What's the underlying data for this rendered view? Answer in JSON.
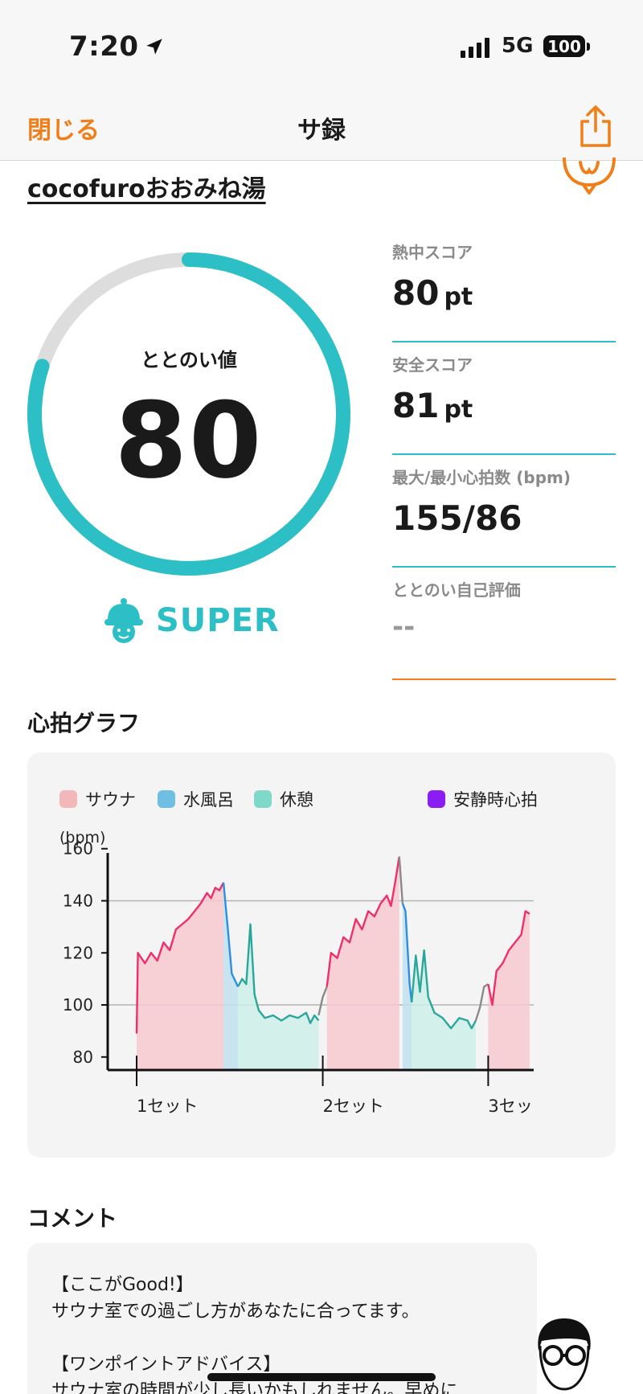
{
  "status_bar": {
    "time": "7:20",
    "network": "5G",
    "battery": "100"
  },
  "navbar": {
    "close_label": "閉じる",
    "title": "サ録"
  },
  "facility_name": "cocofuroおおみね湯",
  "totonoi": {
    "label": "ととのい値",
    "value": 80,
    "gauge_percent": 80,
    "rank": "SUPER"
  },
  "stats": [
    {
      "label": "熱中スコア",
      "value": "80",
      "unit": "pt"
    },
    {
      "label": "安全スコア",
      "value": "81",
      "unit": "pt"
    },
    {
      "label": "最大/最小心拍数 (bpm)",
      "value": "155/86",
      "unit": ""
    },
    {
      "label": "ととのい自己評価",
      "value": "--",
      "unit": ""
    }
  ],
  "heart_section_title": "心拍グラフ",
  "colors": {
    "accent_orange": "#f07f1a",
    "teal": "#2cbfc6",
    "sauna": "#ef2f6b",
    "sauna_fill": "#f6c9cf",
    "bath": "#2f8ee0",
    "bath_fill": "#bfe0ee",
    "rest": "#2aa79b",
    "rest_fill": "#cdeee7",
    "resting_hr": "#8a1ef2",
    "gauge_track": "#dddddd"
  },
  "chart_data": {
    "type": "line",
    "ylabel": "(bpm)",
    "yticks": [
      80,
      100,
      120,
      140,
      160
    ],
    "ylim": [
      75,
      163
    ],
    "reference_lines": [
      100,
      140
    ],
    "legend": [
      {
        "name": "サウナ",
        "color": "#f2b7b9"
      },
      {
        "name": "水風呂",
        "color": "#6fbfe2"
      },
      {
        "name": "休憩",
        "color": "#7fd8c9"
      },
      {
        "name": "安静時心拍",
        "color": "#8a1ef2"
      }
    ],
    "set_labels": [
      "1セット",
      "2セット",
      "3セッ"
    ],
    "set_positions": [
      0,
      45,
      85
    ],
    "xlim": [
      -7,
      96
    ],
    "segments": [
      {
        "phase": "sauna",
        "points": [
          [
            0,
            89
          ],
          [
            0.3,
            120
          ],
          [
            2,
            116
          ],
          [
            3.5,
            120
          ],
          [
            5,
            117
          ],
          [
            6.5,
            124
          ],
          [
            8,
            121
          ],
          [
            9.5,
            129
          ],
          [
            11,
            131
          ],
          [
            12.5,
            133
          ],
          [
            14,
            136
          ],
          [
            15.5,
            139
          ],
          [
            17,
            143
          ],
          [
            18,
            141
          ],
          [
            19,
            145
          ],
          [
            20,
            144
          ],
          [
            21,
            147
          ]
        ]
      },
      {
        "phase": "bath",
        "points": [
          [
            21,
            147
          ],
          [
            22,
            130
          ],
          [
            23,
            112
          ],
          [
            24.5,
            107
          ]
        ]
      },
      {
        "phase": "rest",
        "points": [
          [
            24.5,
            107
          ],
          [
            25.5,
            110
          ],
          [
            26.5,
            108
          ],
          [
            27.5,
            131
          ],
          [
            28.5,
            104
          ],
          [
            29.5,
            98
          ],
          [
            31,
            95
          ],
          [
            33,
            96
          ],
          [
            35,
            94
          ],
          [
            37,
            96
          ],
          [
            39,
            95
          ],
          [
            41,
            97
          ],
          [
            42,
            93
          ],
          [
            43,
            96
          ],
          [
            44,
            94
          ]
        ]
      },
      {
        "phase": "other",
        "points": [
          [
            44,
            96
          ],
          [
            45,
            103
          ],
          [
            46,
            107
          ]
        ]
      },
      {
        "phase": "sauna",
        "points": [
          [
            46,
            107
          ],
          [
            47,
            120
          ],
          [
            48.5,
            118
          ],
          [
            50,
            126
          ],
          [
            51.5,
            124
          ],
          [
            53,
            133
          ],
          [
            54.5,
            129
          ],
          [
            56,
            136
          ],
          [
            57.5,
            134
          ],
          [
            59,
            139
          ],
          [
            60.5,
            142
          ],
          [
            61.5,
            138
          ],
          [
            62.5,
            147
          ],
          [
            63.5,
            157
          ]
        ]
      },
      {
        "phase": "other",
        "points": [
          [
            63.5,
            157
          ],
          [
            64.3,
            139
          ]
        ]
      },
      {
        "phase": "bath",
        "points": [
          [
            64.3,
            139
          ],
          [
            65,
            136
          ],
          [
            66,
            108
          ],
          [
            66.5,
            101
          ]
        ]
      },
      {
        "phase": "rest",
        "points": [
          [
            66.5,
            101
          ],
          [
            67.5,
            119
          ],
          [
            68.5,
            105
          ],
          [
            69.5,
            121
          ],
          [
            70.5,
            103
          ],
          [
            72,
            97
          ],
          [
            74,
            95
          ],
          [
            76,
            91
          ],
          [
            78,
            95
          ],
          [
            80,
            94
          ],
          [
            81,
            91
          ],
          [
            82,
            94
          ]
        ]
      },
      {
        "phase": "other",
        "points": [
          [
            82,
            94
          ],
          [
            83,
            99
          ],
          [
            84,
            107
          ],
          [
            85,
            108
          ]
        ]
      },
      {
        "phase": "sauna",
        "points": [
          [
            85,
            108
          ],
          [
            86,
            100
          ],
          [
            87,
            113
          ],
          [
            88.5,
            116
          ],
          [
            90,
            121
          ],
          [
            91.5,
            124
          ],
          [
            93,
            127
          ],
          [
            94,
            136
          ],
          [
            95,
            135
          ]
        ]
      }
    ]
  },
  "comment": {
    "title": "コメント",
    "lines": [
      "【ここがGood!】",
      "サウナ室での過ごし方があなたに合ってます。",
      "",
      "【ワンポイントアドバイス】",
      "サウナ室の時間が少し長いかもしれません。早めに"
    ]
  }
}
